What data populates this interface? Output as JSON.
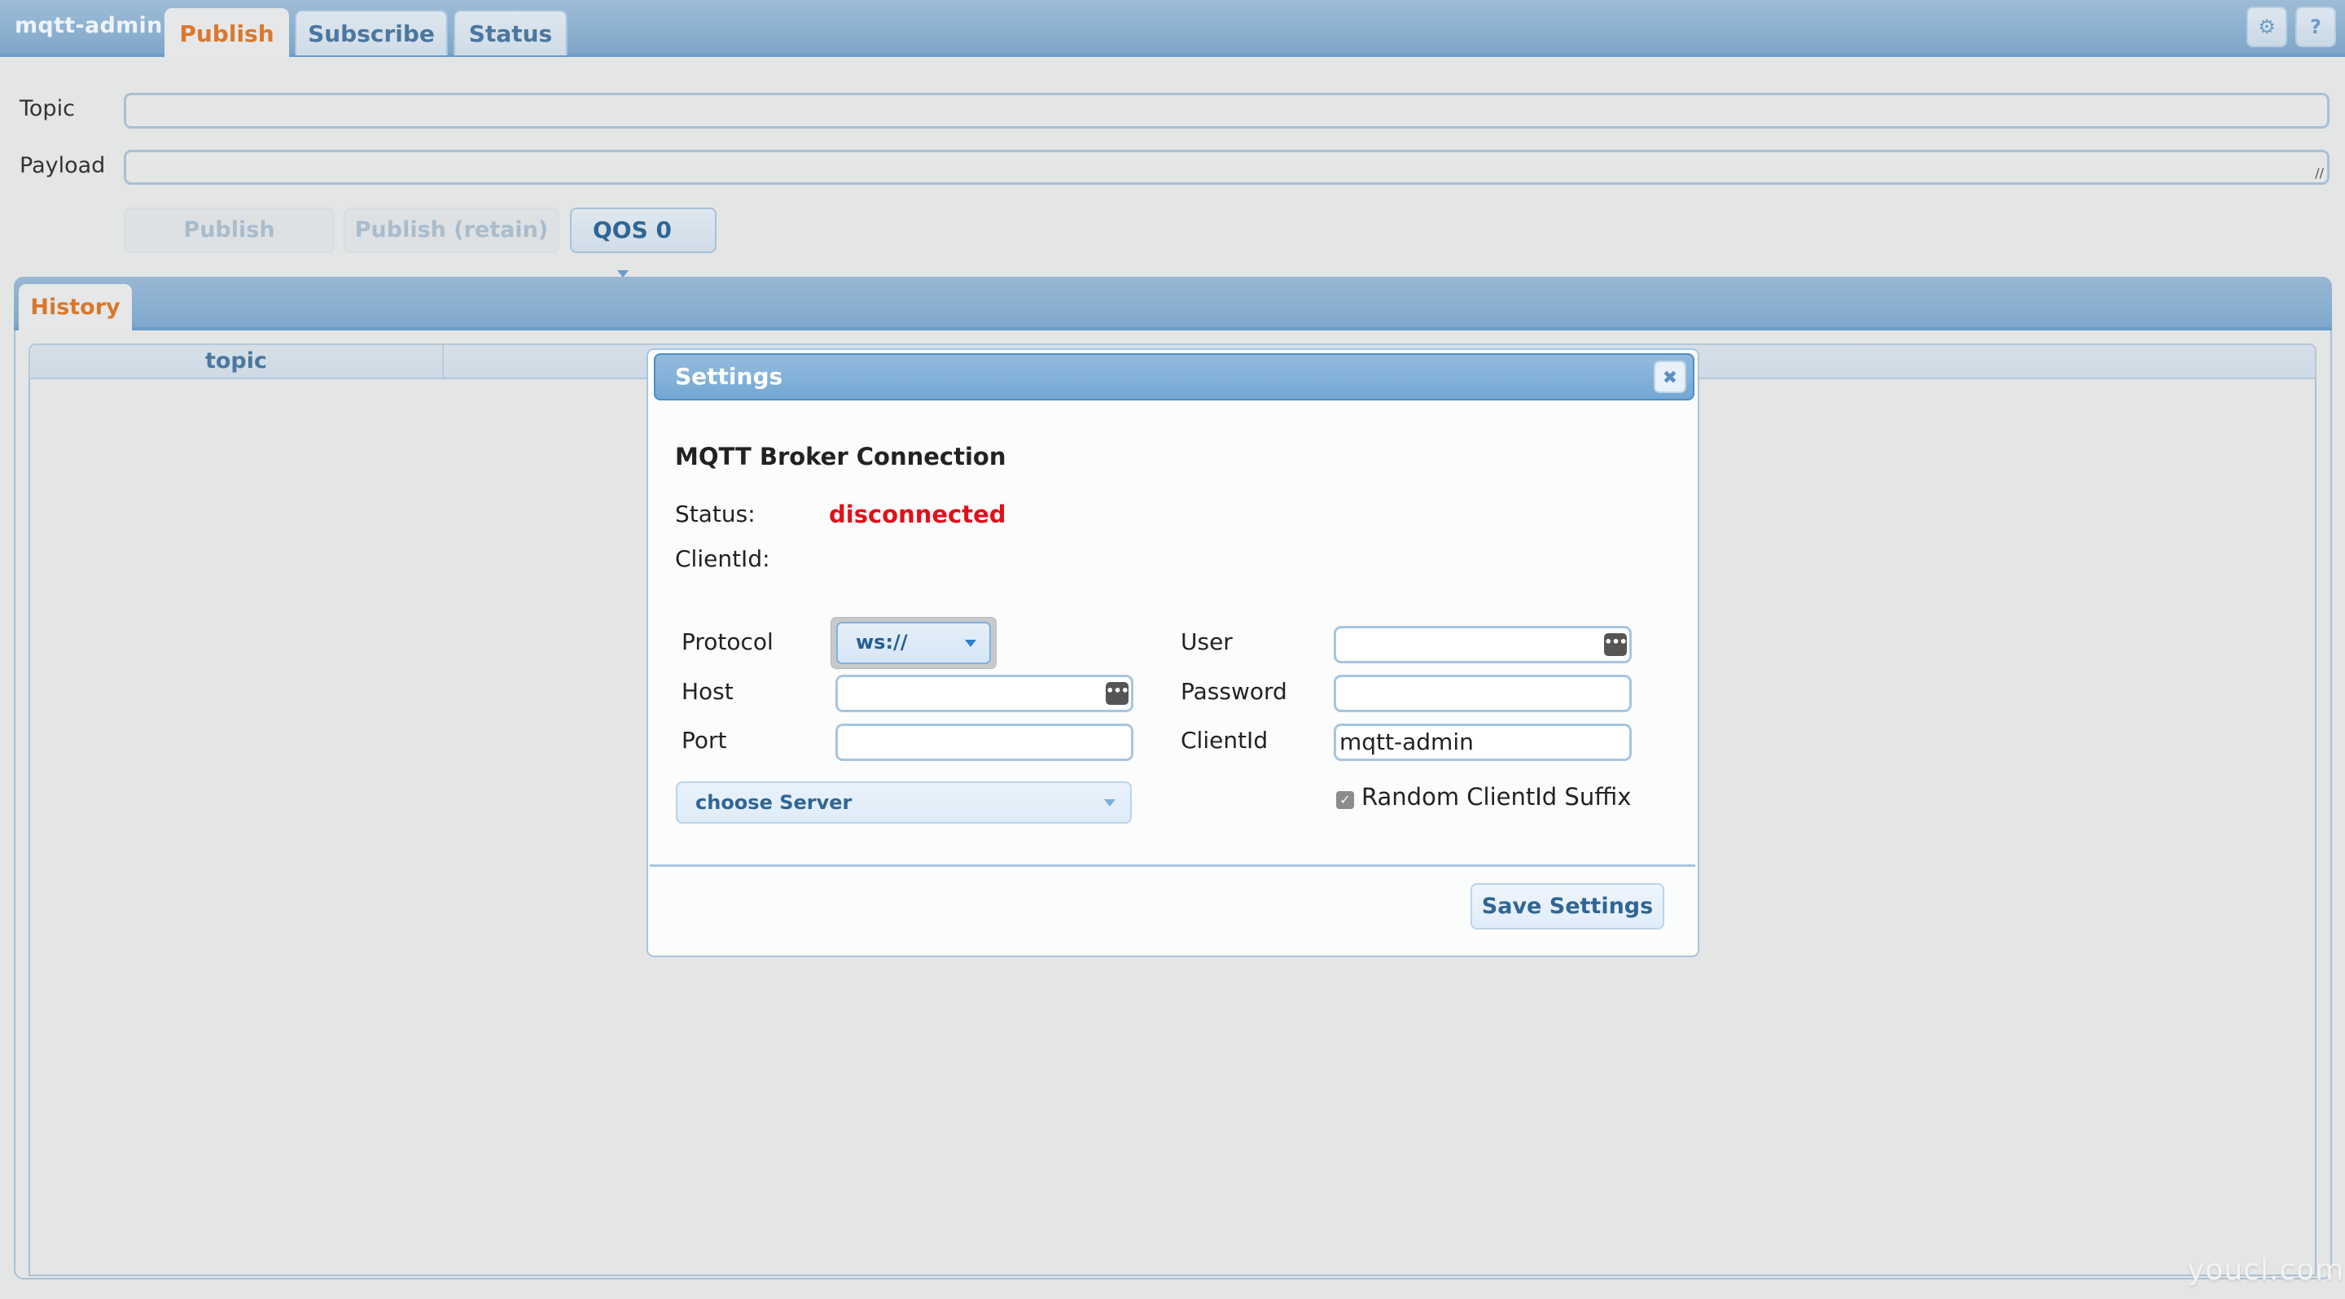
{
  "app": {
    "title": "mqtt-admin",
    "tabs": [
      {
        "label": "Publish",
        "active": true
      },
      {
        "label": "Subscribe",
        "active": false
      },
      {
        "label": "Status",
        "active": false
      }
    ],
    "toolbar": {
      "settings_icon": "⚙",
      "help_icon": "?"
    }
  },
  "publish": {
    "topic_label": "Topic",
    "topic_value": "",
    "payload_label": "Payload",
    "payload_value": "",
    "publish_button": "Publish",
    "publish_retain_button": "Publish (retain)",
    "qos_selected": "QOS 0"
  },
  "history": {
    "tab_label": "History",
    "columns": [
      "topic"
    ],
    "rows": []
  },
  "settings_dialog": {
    "title": "Settings",
    "close_icon": "✖",
    "heading": "MQTT Broker Connection",
    "status_label": "Status:",
    "status_value": "disconnected",
    "status_color": "#e3101a",
    "clientid_label": "ClientId:",
    "clientid_value": "",
    "protocol_label": "Protocol",
    "protocol_value": "ws://",
    "host_label": "Host",
    "host_value": "",
    "port_label": "Port",
    "port_value": "",
    "server_select": "choose Server",
    "user_label": "User",
    "user_value": "",
    "password_label": "Password",
    "password_value": "",
    "clientid_field_label": "ClientId",
    "clientid_field_value": "mqtt-admin",
    "random_suffix_label": "Random ClientId Suffix",
    "random_suffix_checked": true,
    "keychain_icon": "•••",
    "save_button": "Save Settings"
  },
  "watermark": "youcl.com"
}
